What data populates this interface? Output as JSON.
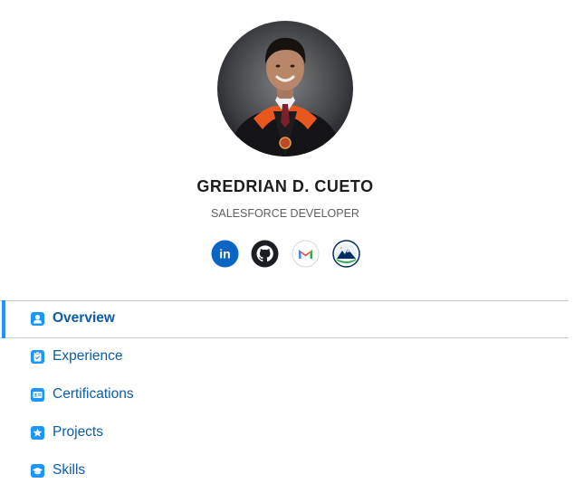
{
  "profile": {
    "name": "GREDRIAN D. CUETO",
    "role": "SALESFORCE DEVELOPER",
    "avatar_icon": "graduation-photo-avatar"
  },
  "socials": [
    {
      "icon": "linkedin-icon",
      "glyph": "in",
      "color": "#0a66c2"
    },
    {
      "icon": "github-icon",
      "color": "#1b1f23"
    },
    {
      "icon": "gmail-icon",
      "glyph": "M",
      "color": "#ea4335"
    },
    {
      "icon": "trailhead-icon",
      "color": "#032d60"
    }
  ],
  "nav": {
    "accent": "#1b96ff",
    "label_color": "#0b5cab",
    "items": [
      {
        "label": "Overview",
        "icon": "user-icon",
        "active": true
      },
      {
        "label": "Experience",
        "icon": "clipboard-icon",
        "active": false
      },
      {
        "label": "Certifications",
        "icon": "id-card-icon",
        "active": false
      },
      {
        "label": "Projects",
        "icon": "star-icon",
        "active": false
      },
      {
        "label": "Skills",
        "icon": "graduation-cap-icon",
        "active": false
      }
    ]
  }
}
